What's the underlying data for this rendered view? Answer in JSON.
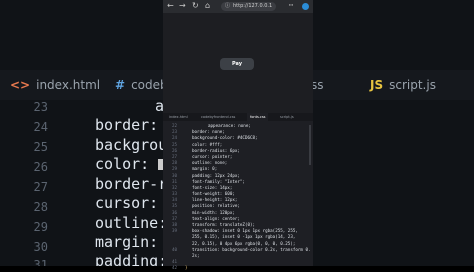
{
  "background": {
    "tabs": [
      {
        "icon": "<>",
        "label": "index.html"
      },
      {
        "icon": "#",
        "label": "codeb"
      },
      {
        "icon": "",
        "label": "ss"
      },
      {
        "icon": "JS",
        "label": "script.js"
      }
    ],
    "lines": [
      {
        "num": "23",
        "prop": "",
        "val": "a"
      },
      {
        "num": "24",
        "prop": "border:",
        "val": "n"
      },
      {
        "num": "25",
        "prop": "backgroun",
        "val": ""
      },
      {
        "num": "26",
        "prop": "color:",
        "val": ""
      },
      {
        "num": "27",
        "prop": "border-ra",
        "val": ""
      },
      {
        "num": "28",
        "prop": "cursor:",
        "val": "p"
      },
      {
        "num": "29",
        "prop": "outline:",
        "val": ""
      },
      {
        "num": "30",
        "prop": "margin:",
        "val": "0"
      },
      {
        "num": "31",
        "prop": "padding:",
        "val": ""
      }
    ]
  },
  "browser": {
    "back": "←",
    "forward": "→",
    "reload": "↻",
    "home": "⌂",
    "url": "http://127.0.0.1",
    "menu": "⋯"
  },
  "preview": {
    "pay_label": "Pay"
  },
  "editor": {
    "tabs": [
      "index.html",
      "codebyfrontend.css",
      "fonts.css",
      "script.js"
    ],
    "lines": [
      {
        "num": "22",
        "text": "appearance: none;"
      },
      {
        "num": "23",
        "text": "border: none;"
      },
      {
        "num": "24",
        "text": "background-color: #4CD6C8;"
      },
      {
        "num": "25",
        "text": "color: #fff;"
      },
      {
        "num": "26",
        "text": "border-radius: 6px;"
      },
      {
        "num": "27",
        "text": "cursor: pointer;"
      },
      {
        "num": "28",
        "text": "outline: none;"
      },
      {
        "num": "29",
        "text": "margin: 0;"
      },
      {
        "num": "30",
        "text": "padding: 12px 24px;"
      },
      {
        "num": "31",
        "text": "font-family: \"Inter\";"
      },
      {
        "num": "32",
        "text": "font-size: 14px;"
      },
      {
        "num": "33",
        "text": "font-weight: 600;"
      },
      {
        "num": "34",
        "text": "line-height: 12px;"
      },
      {
        "num": "35",
        "text": "position: relative;"
      },
      {
        "num": "36",
        "text": "min-width: 120px;"
      },
      {
        "num": "37",
        "text": "text-align: center;"
      },
      {
        "num": "38",
        "text": "transform: translateZ(0);"
      },
      {
        "num": "39",
        "text": "box-shadow: inset 0 1px 1px rgba(255, 255,"
      },
      {
        "num": "",
        "text": "255, 0.15), inset 0 -1px 1px rgba(14, 23,"
      },
      {
        "num": "",
        "text": "22, 0.15), 0 4px 6px rgba(0, 0, 0, 0.25);"
      },
      {
        "num": "40",
        "text": "transition: background-color 0.2s, transform 0."
      },
      {
        "num": "",
        "text": "2s;"
      },
      {
        "num": "41",
        "text": ""
      },
      {
        "num": "42",
        "text": "}"
      }
    ]
  }
}
